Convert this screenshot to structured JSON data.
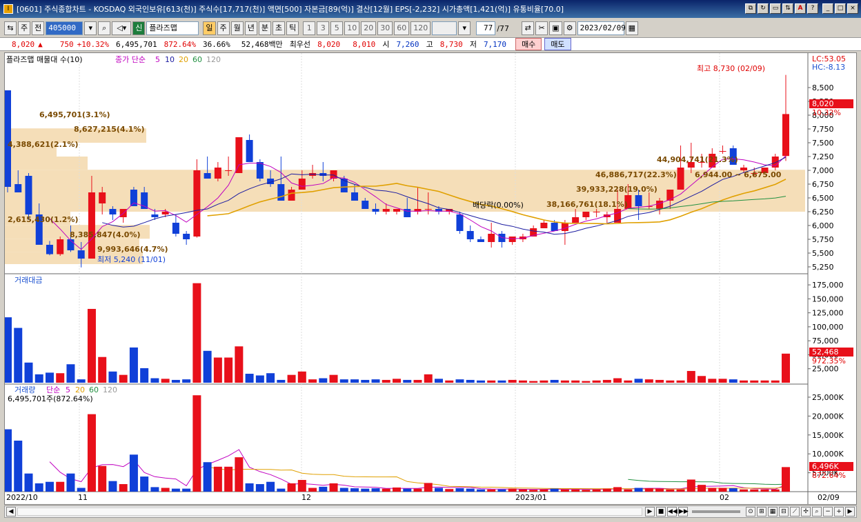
{
  "window": {
    "title": "[0601] 주식종합차트 - KOSDAQ 외국인보유[613(천)] 주식수[17,717(천)] 액면[500] 자본금[89(억)] 결산[12월] EPS[-2,232] 시가총액[1,421(억)] 유통비율[70.0]",
    "app_icon": "chart-app-icon",
    "controls": [
      "⧉",
      "↻",
      "▭",
      "⇅",
      "A",
      "?",
      "_",
      "□",
      "×"
    ]
  },
  "toolbar": {
    "market": "주",
    "prev": "전",
    "code": "405000",
    "flag": "신",
    "name": "플라즈맵",
    "periods": [
      "일",
      "주",
      "월",
      "년",
      "분",
      "초",
      "틱"
    ],
    "intervals": [
      "1",
      "3",
      "5",
      "10",
      "20",
      "30",
      "60",
      "120"
    ],
    "count": "77",
    "total": "/77",
    "date": "2023/02/09"
  },
  "quote": {
    "price": "8,020",
    "change_arrow": "▲",
    "change": "750",
    "change_pct": "+10.32%",
    "volume": "6,495,701",
    "volume_pct": "872.64%",
    "ratio": "36.66%",
    "amount": "52,468백만",
    "best_ask_label": "최우선",
    "best_ask": "8,020",
    "best_bid": "8,010",
    "open_label": "시",
    "open": "7,260",
    "high_label": "고",
    "high": "8,730",
    "low_label": "저",
    "low": "7,170",
    "buy": "매수",
    "sell": "매도"
  },
  "panels": {
    "price": {
      "legend_name": "플라즈맵 매물대 수(10)",
      "legend_ma": "종가 단순",
      "ma_periods": [
        "5",
        "10",
        "20",
        "60",
        "120"
      ],
      "lc": "LC:53.05",
      "hc": "HC:-8.13",
      "axis": [
        "8,500",
        "8,250",
        "8,000",
        "7,750",
        "7,500",
        "7,250",
        "7,000",
        "6,750",
        "6,500",
        "6,250",
        "6,000",
        "5,750",
        "5,500",
        "5,250"
      ],
      "last_value": "8,020",
      "last_pct": "10.32%",
      "high_note": "최고 8,730 (02/09)",
      "low_note": "최저 5,240 (11/01)",
      "dividend_note": "배당락(0.00%)",
      "volume_profile": [
        "6,495,701(3.1%)",
        "8,627,215(4.1%)",
        "4,388,621(2.1%)",
        "2,615,430(1.2%)",
        "8,385,847(4.0%)",
        "9,993,646(4.7%)",
        "44,904,741(21.3%)",
        "46,886,717(22.3%)",
        "39,933,228(19.0%)",
        "38,166,761(18.1%)"
      ],
      "range_note": "6,944.00 ~ 6,675.00"
    },
    "amount": {
      "legend": "거래대금",
      "axis": [
        "175,000",
        "150,000",
        "125,000",
        "100,000",
        "75,000",
        "50,000",
        "25,000"
      ],
      "last_value": "52,468",
      "last_pct": "972.35%"
    },
    "volume": {
      "legend_name": "거래량",
      "legend_ma": "단순",
      "ma_periods": [
        "5",
        "20",
        "60",
        "120"
      ],
      "sub": "6,495,701주(872.64%)",
      "axis": [
        "25,000K",
        "20,000K",
        "15,000K",
        "10,000K",
        "5,000K"
      ],
      "last_value": "6,496K",
      "last_pct": "872.64%"
    }
  },
  "dates": [
    "2022/10",
    "11",
    "12",
    "2023/01",
    "02",
    "02/09"
  ],
  "colors": {
    "up": "#e8101a",
    "down": "#1040d8",
    "ma5": "#c000c0",
    "ma10": "#1a1aa0",
    "ma20": "#e0a000",
    "ma60": "#209040",
    "vp": "#f5deb8"
  },
  "chart_data": {
    "type": "candlestick",
    "candles": [
      [
        8450,
        7450,
        6600,
        6700
      ],
      [
        6750,
        7000,
        6600,
        6600
      ],
      [
        6900,
        6950,
        6100,
        6200
      ],
      [
        6200,
        6400,
        5650,
        5650
      ],
      [
        5650,
        5720,
        5460,
        5480
      ],
      [
        5480,
        5800,
        5450,
        5750
      ],
      [
        5750,
        6000,
        5520,
        5550
      ],
      [
        5550,
        5700,
        5240,
        5400
      ],
      [
        5400,
        6900,
        5400,
        6600
      ],
      [
        6400,
        6700,
        6200,
        6600
      ],
      [
        6300,
        6350,
        6100,
        6200
      ],
      [
        6150,
        6300,
        6050,
        6300
      ],
      [
        6650,
        6700,
        6350,
        6350
      ],
      [
        6600,
        6700,
        6300,
        6300
      ],
      [
        6200,
        6300,
        6100,
        6150
      ],
      [
        6200,
        6300,
        6150,
        6250
      ],
      [
        6050,
        6200,
        5800,
        5850
      ],
      [
        5850,
        5900,
        5650,
        5750
      ],
      [
        5800,
        7200,
        5780,
        7000
      ],
      [
        6950,
        7250,
        6850,
        6850
      ],
      [
        6850,
        7150,
        6800,
        7050
      ],
      [
        7000,
        7250,
        6900,
        7000
      ],
      [
        6950,
        7600,
        6950,
        7600
      ],
      [
        7550,
        7650,
        7150,
        7150
      ],
      [
        7150,
        7200,
        6800,
        6850
      ],
      [
        6850,
        7000,
        6700,
        6750
      ],
      [
        6750,
        7250,
        6550,
        6450
      ],
      [
        6450,
        6700,
        6450,
        6650
      ],
      [
        6650,
        7000,
        6650,
        6850
      ],
      [
        6900,
        7100,
        6850,
        6950
      ],
      [
        6950,
        7150,
        6800,
        6900
      ],
      [
        6850,
        7000,
        6800,
        7000
      ],
      [
        6850,
        6900,
        6650,
        6600
      ],
      [
        6600,
        6750,
        6450,
        6450
      ],
      [
        6450,
        6500,
        6300,
        6300
      ],
      [
        6300,
        6400,
        6200,
        6250
      ],
      [
        6250,
        6400,
        6200,
        6300
      ],
      [
        6250,
        6300,
        6200,
        6300
      ],
      [
        6300,
        6500,
        6200,
        6150
      ],
      [
        6250,
        6700,
        6200,
        6300
      ],
      [
        6300,
        6600,
        6200,
        6300
      ],
      [
        6300,
        6350,
        6200,
        6250
      ],
      [
        6250,
        6300,
        6200,
        6300
      ],
      [
        6200,
        6250,
        5850,
        5900
      ],
      [
        5900,
        6000,
        5700,
        5750
      ],
      [
        5750,
        5800,
        5700,
        5700
      ],
      [
        5700,
        6050,
        5600,
        5850
      ],
      [
        5850,
        5900,
        5600,
        5700
      ],
      [
        5700,
        5800,
        5650,
        5800
      ],
      [
        5750,
        5850,
        5700,
        5800
      ],
      [
        5800,
        6000,
        5800,
        5950
      ],
      [
        5950,
        6100,
        5950,
        6050
      ],
      [
        6050,
        6100,
        5900,
        5900
      ],
      [
        5900,
        6100,
        5650,
        6050
      ],
      [
        6050,
        6300,
        6050,
        6150
      ],
      [
        6150,
        6250,
        6100,
        6250
      ],
      [
        6250,
        6300,
        6150,
        6250
      ],
      [
        6150,
        6250,
        6050,
        6200
      ],
      [
        6050,
        6650,
        6050,
        6300
      ],
      [
        6300,
        6750,
        6300,
        6550
      ],
      [
        6550,
        6650,
        6100,
        6350
      ],
      [
        6350,
        6600,
        6300,
        6350
      ],
      [
        6300,
        6500,
        6200,
        6450
      ],
      [
        6450,
        6650,
        6300,
        6650
      ],
      [
        6650,
        7450,
        6650,
        7050
      ],
      [
        7050,
        7500,
        6950,
        7150
      ],
      [
        7150,
        7300,
        7050,
        7150
      ],
      [
        7050,
        7400,
        7050,
        7300
      ],
      [
        7350,
        7450,
        7300,
        7350
      ],
      [
        7400,
        7450,
        7100,
        7100
      ],
      [
        7000,
        7100,
        6950,
        7050
      ],
      [
        6950,
        7050,
        6900,
        6950
      ],
      [
        6950,
        7050,
        6950,
        7050
      ],
      [
        7050,
        7300,
        7000,
        7250
      ],
      [
        7260,
        8730,
        7170,
        8020
      ]
    ],
    "amount_values": [
      117,
      98,
      36,
      15,
      18,
      17,
      33,
      6,
      132,
      46,
      20,
      14,
      63,
      26,
      8,
      7,
      5,
      6,
      178,
      57,
      45,
      45,
      65,
      16,
      13,
      17,
      5,
      14,
      20,
      6,
      8,
      14,
      6,
      6,
      5,
      6,
      5,
      7,
      5,
      5,
      15,
      7,
      4,
      6,
      5,
      4,
      4,
      4,
      5,
      4,
      3,
      4,
      5,
      4,
      4,
      3,
      4,
      5,
      8,
      4,
      7,
      6,
      5,
      4,
      4,
      21,
      12,
      7,
      7,
      6,
      4,
      4,
      4,
      4,
      52
    ],
    "volume_values": [
      16.5,
      13.5,
      4.8,
      2.2,
      2.6,
      2.6,
      4.8,
      1.0,
      20.5,
      6.8,
      2.8,
      2.0,
      9.8,
      4.0,
      1.2,
      1.0,
      0.8,
      0.8,
      25.5,
      7.8,
      6.6,
      6.6,
      9.1,
      2.2,
      2.0,
      2.6,
      0.8,
      2.2,
      3.1,
      1.0,
      1.3,
      2.2,
      1.0,
      0.9,
      0.8,
      0.9,
      0.8,
      1.1,
      0.8,
      0.8,
      2.3,
      1.0,
      0.7,
      0.9,
      0.8,
      0.6,
      0.6,
      0.6,
      0.8,
      0.6,
      0.5,
      0.6,
      0.8,
      0.6,
      0.6,
      0.5,
      0.6,
      0.8,
      1.2,
      0.6,
      1.0,
      0.9,
      0.8,
      0.6,
      0.6,
      3.2,
      1.8,
      1.0,
      1.0,
      0.9,
      0.6,
      0.6,
      0.6,
      0.6,
      6.5
    ],
    "ylim_price": [
      5150,
      8900
    ],
    "ylim_amount": [
      0,
      185
    ],
    "ylim_volume": [
      0,
      27
    ]
  }
}
